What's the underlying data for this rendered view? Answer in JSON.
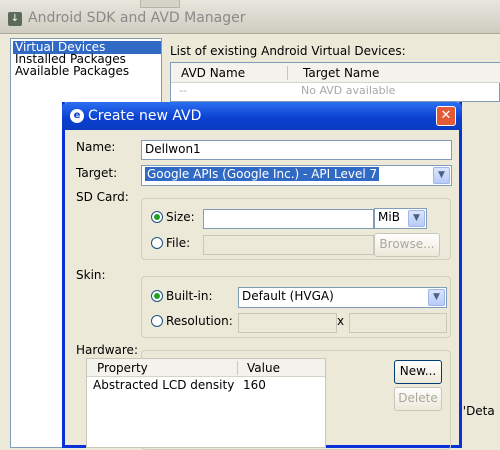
{
  "bg_window": {
    "title": "Android SDK and AVD Manager",
    "sidebar_items": [
      "Virtual Devices",
      "Installed Packages",
      "Available Packages"
    ],
    "caption": "List of existing Android Virtual Devices:",
    "table_headers": [
      "AVD Name",
      "Target Name"
    ],
    "empty_row": [
      "--",
      "No AVD available"
    ],
    "right_edge_text": "k 'Deta"
  },
  "dialog": {
    "title": "Create new AVD",
    "name_label": "Name:",
    "name_value": "Dellwon1",
    "target_label": "Target:",
    "target_value": "Google APIs (Google Inc.) - API Level 7",
    "sdcard_label": "SD Card:",
    "size_label": "Size:",
    "size_value": "",
    "size_unit": "MiB",
    "file_label": "File:",
    "file_value": "",
    "browse_label": "Browse...",
    "skin_label": "Skin:",
    "builtin_label": "Built-in:",
    "builtin_value": "Default (HVGA)",
    "resolution_label": "Resolution:",
    "resolution_x": "x",
    "hardware_label": "Hardware:",
    "hw_headers": [
      "Property",
      "Value"
    ],
    "hw_rows": [
      {
        "property": "Abstracted LCD density",
        "value": "160"
      }
    ],
    "new_button": "New...",
    "delete_button": "Delete"
  }
}
